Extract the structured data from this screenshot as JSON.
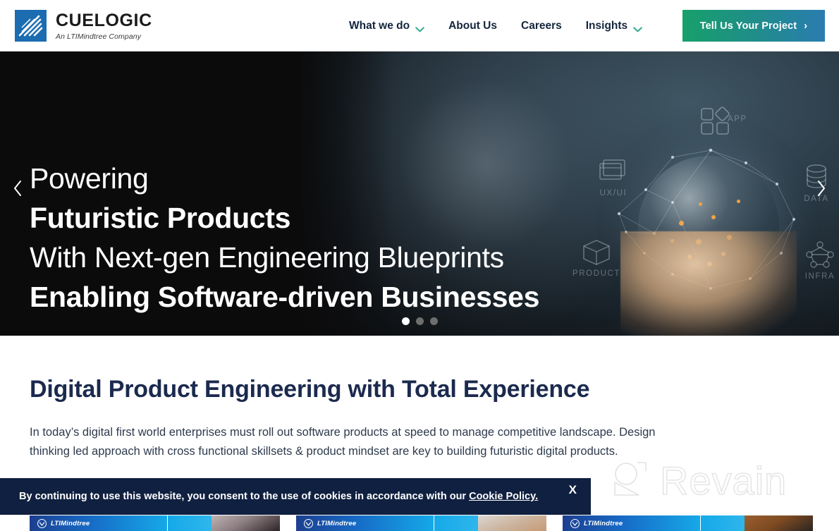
{
  "header": {
    "logo": {
      "name": "CUELOGIC",
      "tagline": "An LTIMindtree Company",
      "mark_icon": "cuelogic-diagonal-stripes-icon",
      "mark_color": "#1b6cb0"
    },
    "nav": [
      {
        "label": "What we do",
        "has_dropdown": true,
        "chevron_icon": "chevron-down-icon"
      },
      {
        "label": "About Us",
        "has_dropdown": false,
        "chevron_icon": ""
      },
      {
        "label": "Careers",
        "has_dropdown": false,
        "chevron_icon": ""
      },
      {
        "label": "Insights",
        "has_dropdown": true,
        "chevron_icon": "chevron-down-icon"
      }
    ],
    "cta": {
      "label": "Tell Us Your Project",
      "arrow": "›",
      "gradient_from": "#17a06b",
      "gradient_to": "#2a7cb0"
    },
    "nav_chevron_color": "#3aab8f",
    "nav_text_color": "#14263d"
  },
  "hero": {
    "background_color": "#0b0b0c",
    "headline_lines": [
      {
        "text": "Powering",
        "weight": "regular"
      },
      {
        "text": "Futuristic Products",
        "weight": "bold"
      },
      {
        "text": "With Next-gen Engineering Blueprints",
        "weight": "regular"
      },
      {
        "text": "Enabling Software-driven Businesses",
        "weight": "bold"
      }
    ],
    "image_description": "hand holding glowing digital globe",
    "overlay_icons": [
      {
        "label": "APP",
        "icon": "app-squares-icon"
      },
      {
        "label": "UX/UI",
        "icon": "ux-ui-windows-icon"
      },
      {
        "label": "PRODUCT",
        "icon": "product-box-icon"
      },
      {
        "label": "DATA",
        "icon": "data-database-icon"
      },
      {
        "label": "INFRA",
        "icon": "infra-network-icon"
      }
    ],
    "carousel": {
      "prev_icon": "chevron-left-icon",
      "next_icon": "chevron-right-icon",
      "prev_label": "‹",
      "next_label": "›",
      "slide_count": 3,
      "active_slide": 1
    }
  },
  "main": {
    "section_title": "Digital Product Engineering with Total Experience",
    "section_title_color": "#1b2a4e",
    "section_body": "In today’s digital first world enterprises must roll out software products at speed to manage competitive landscape. Design thinking led approach with cross functional skillsets & product mindset are key to building futuristic digital products.",
    "cards": [
      {
        "brand": "LTIMindtree",
        "brand_icon": "ltimindtree-logo-icon",
        "photo": "a"
      },
      {
        "brand": "LTIMindtree",
        "brand_icon": "ltimindtree-logo-icon",
        "photo": "b"
      },
      {
        "brand": "LTIMindtree",
        "brand_icon": "ltimindtree-logo-icon",
        "photo": "c"
      }
    ]
  },
  "watermark": {
    "text": "Revain",
    "icon": "revain-arrow-logo-icon",
    "color": "#e2e2e2"
  },
  "cookie_banner": {
    "message_before": "By continuing to use this website, you consent to the use of cookies in accordance with our ",
    "link_label": "Cookie Policy.",
    "close_label": "X",
    "close_icon": "close-icon",
    "background": "#102040"
  }
}
